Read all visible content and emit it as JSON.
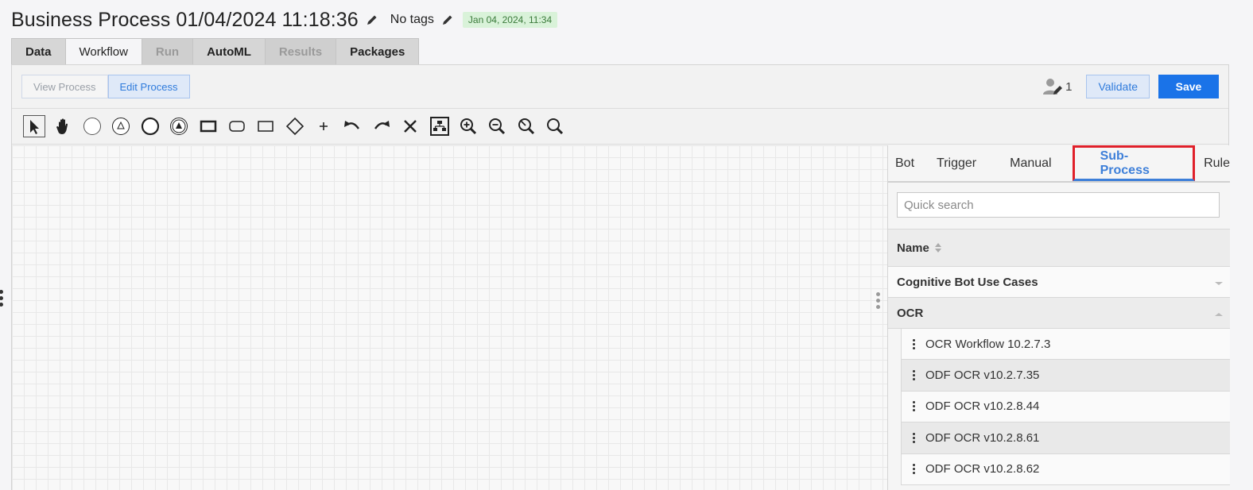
{
  "header": {
    "title": "Business Process 01/04/2024 11:18:36",
    "tags_label": "No tags",
    "date_badge": "Jan 04, 2024, 11:34"
  },
  "tabs": [
    {
      "label": "Data",
      "state": "normal"
    },
    {
      "label": "Workflow",
      "state": "active"
    },
    {
      "label": "Run",
      "state": "disabled"
    },
    {
      "label": "AutoML",
      "state": "normal"
    },
    {
      "label": "Results",
      "state": "disabled"
    },
    {
      "label": "Packages",
      "state": "normal"
    }
  ],
  "mode": {
    "view_label": "View Process",
    "edit_label": "Edit Process"
  },
  "actions": {
    "users_count": "1",
    "validate_label": "Validate",
    "save_label": "Save"
  },
  "toolbar_icons": [
    "pointer-icon",
    "hand-icon",
    "start-event-icon",
    "triangle-event-icon",
    "end-event-icon",
    "filled-triangle-event-icon",
    "task-icon",
    "rounded-task-icon",
    "rectangle-icon",
    "gateway-icon",
    "plus-icon",
    "undo-icon",
    "redo-icon",
    "delete-icon",
    "auto-layout-icon",
    "zoom-in-icon",
    "zoom-out-icon",
    "zoom-reset-icon",
    "zoom-fit-icon"
  ],
  "panel": {
    "tabs": [
      {
        "label": "Bot"
      },
      {
        "label": "Trigger"
      },
      {
        "label": "Manual"
      },
      {
        "label": "Sub-Process",
        "active": true
      },
      {
        "label": "Rule"
      }
    ],
    "search_placeholder": "Quick search",
    "column_name": "Name",
    "groups": [
      {
        "label": "Cognitive Bot Use Cases",
        "expanded": false
      },
      {
        "label": "OCR",
        "expanded": true
      }
    ],
    "items": [
      "OCR Workflow 10.2.7.3",
      "ODF OCR v10.2.7.35",
      "ODF OCR v10.2.8.44",
      "ODF OCR v10.2.8.61",
      "ODF OCR v10.2.8.62"
    ]
  },
  "colors": {
    "accent": "#1a73e8",
    "active_tab_text": "#3d7fd9",
    "highlight_border": "#e0202a",
    "badge_bg": "#d9f2d9"
  }
}
